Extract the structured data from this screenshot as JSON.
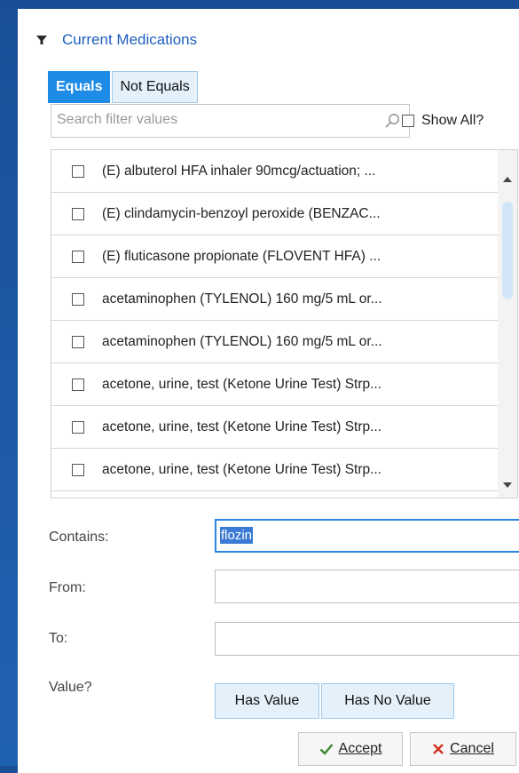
{
  "header": {
    "title": "Current Medications"
  },
  "toggle": {
    "equals": "Equals",
    "not_equals": "Not Equals"
  },
  "search": {
    "placeholder": "Search filter values",
    "show_all_label": "Show All?"
  },
  "items": [
    "(E) albuterol HFA inhaler 90mcg/actuation; ...",
    "(E) clindamycin-benzoyl peroxide (BENZAC...",
    "(E) fluticasone propionate (FLOVENT HFA) ...",
    "acetaminophen (TYLENOL) 160 mg/5 mL or...",
    "acetaminophen (TYLENOL) 160 mg/5 mL or...",
    "acetone, urine, test (Ketone Urine Test) Strp...",
    "acetone, urine, test (Ketone Urine Test) Strp...",
    "acetone, urine, test (Ketone Urine Test) Strp..."
  ],
  "filters": {
    "contains_label": "Contains:",
    "contains_value": "flozin",
    "from_label": "From:",
    "from_value": "",
    "to_label": "To:",
    "to_value": "",
    "value_label": "Value?"
  },
  "value_buttons": {
    "has_value": "Has Value",
    "has_no_value": "Has No Value"
  },
  "actions": {
    "accept": "Accept",
    "cancel": "Cancel"
  },
  "colors": {
    "accent": "#1e8ce6",
    "title": "#1f5fbf",
    "background": "#1d5aa6"
  }
}
